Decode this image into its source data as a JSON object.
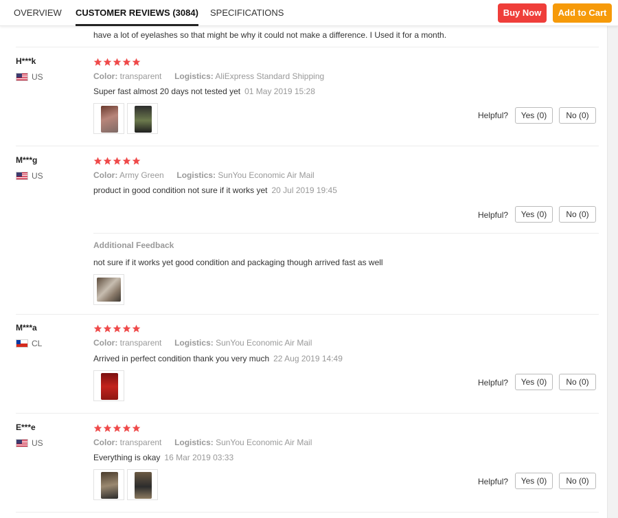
{
  "tabs": [
    {
      "label": "OVERVIEW"
    },
    {
      "label": "CUSTOMER REVIEWS (3084)"
    },
    {
      "label": "SPECIFICATIONS"
    }
  ],
  "actions": {
    "buy_now": "Buy Now",
    "add_to_cart": "Add to Cart"
  },
  "colors": {
    "buy_now": "#ef3e3a",
    "add_to_cart": "#f69a09",
    "star": "#ef4a4a"
  },
  "cutoff_text": "have a lot of eyelashes so that might be why it could not make a difference. I Used it for a month.",
  "labels": {
    "color": "Color:",
    "logistics": "Logistics:",
    "helpful": "Helpful?",
    "additional_feedback": "Additional Feedback"
  },
  "reviews": [
    {
      "user": "H***k",
      "country": "US",
      "flag": "us-flag-icon",
      "stars": 5,
      "color": "transparent",
      "logistics": "AliExpress Standard Shipping",
      "text": "Super fast almost 20 days not tested yet",
      "date": "01 May 2019 15:28",
      "yes": "Yes (0)",
      "no": "No (0)"
    },
    {
      "user": "M***g",
      "country": "US",
      "flag": "us-flag-icon",
      "stars": 5,
      "color": "Army Green",
      "logistics": "SunYou Economic Air Mail",
      "text": "product in good condition not sure if it works yet",
      "date": "20 Jul 2019 19:45",
      "yes": "Yes (0)",
      "no": "No (0)",
      "additional": "not sure if it works yet good condition and packaging though arrived fast as well"
    },
    {
      "user": "M***a",
      "country": "CL",
      "flag": "chile-flag-icon",
      "stars": 5,
      "color": "transparent",
      "logistics": "SunYou Economic Air Mail",
      "text": "Arrived in perfect condition thank you very much",
      "date": "22 Aug 2019 14:49",
      "yes": "Yes (0)",
      "no": "No (0)"
    },
    {
      "user": "E***e",
      "country": "US",
      "flag": "us-flag-icon",
      "stars": 5,
      "color": "transparent",
      "logistics": "SunYou Economic Air Mail",
      "text": "Everything is okay",
      "date": "16 Mar 2019 03:33",
      "yes": "Yes (0)",
      "no": "No (0)"
    }
  ]
}
